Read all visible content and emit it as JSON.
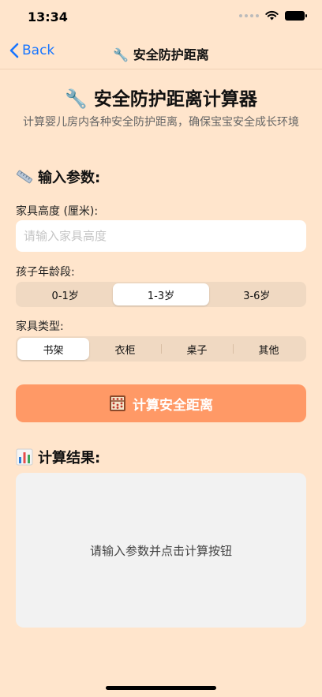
{
  "status_bar": {
    "time": "13:34"
  },
  "nav": {
    "back_label": "Back",
    "title": "🔧 安全防护距离"
  },
  "header": {
    "title": "🔧 安全防护距离计算器",
    "subtitle": "计算婴儿房内各种安全防护距离，确保宝宝安全成长环境"
  },
  "inputs_section": {
    "heading": "输入参数:",
    "height_label": "家具高度 (厘米):",
    "height_placeholder": "请输入家具高度",
    "height_value": "",
    "age_label": "孩子年龄段:",
    "age_options": [
      "0-1岁",
      "1-3岁",
      "3-6岁"
    ],
    "age_selected": "1-3岁",
    "type_label": "家具类型:",
    "type_options": [
      "书架",
      "衣柜",
      "桌子",
      "其他"
    ],
    "type_selected": "书架"
  },
  "action": {
    "calculate_label": "计算安全距离"
  },
  "results_section": {
    "heading": "计算结果:",
    "placeholder": "请输入参数并点击计算按钮"
  },
  "colors": {
    "background": "#FFE5CC",
    "accent_button": "#FF9966",
    "ios_blue": "#1976FF",
    "segment_bg": "#F0D9C2",
    "result_bg": "#F2F2F2"
  },
  "icons": {
    "ruler": "straight-ruler-icon",
    "abacus": "abacus-icon",
    "chart": "bar-chart-icon"
  }
}
